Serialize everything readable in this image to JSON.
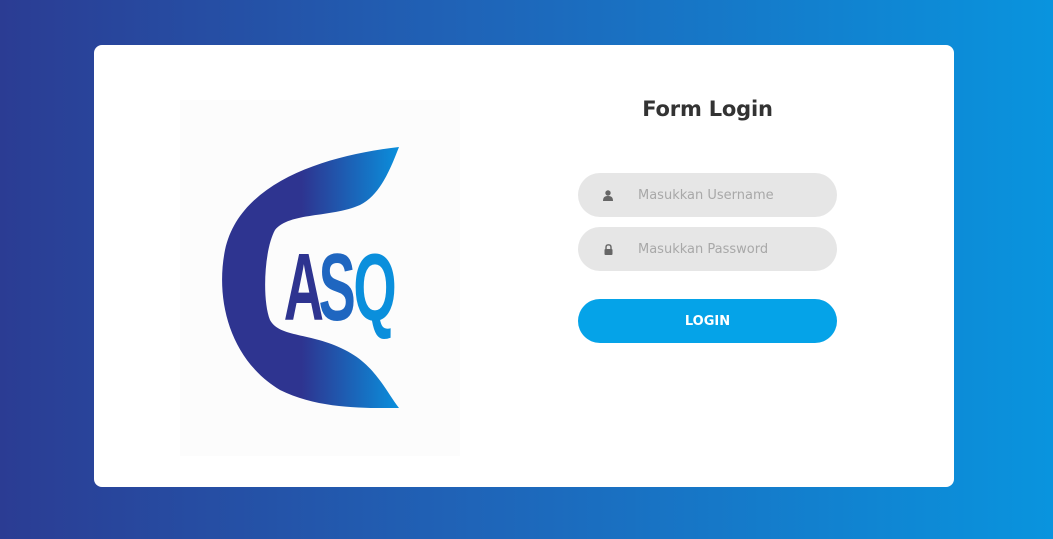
{
  "logo": {
    "text": "ASQ",
    "colors": {
      "dark": "#2e3490",
      "light": "#0a8fdc"
    }
  },
  "form": {
    "title": "Form Login",
    "username_placeholder": "Masukkan Username",
    "password_placeholder": "Masukkan Password",
    "username_icon": "user-icon",
    "password_icon": "lock-icon",
    "login_label": "LOGIN"
  },
  "colors": {
    "bg_start": "#2b3c93",
    "bg_end": "#0994de",
    "button": "#05a3e8",
    "input_bg": "#e6e6e6"
  }
}
